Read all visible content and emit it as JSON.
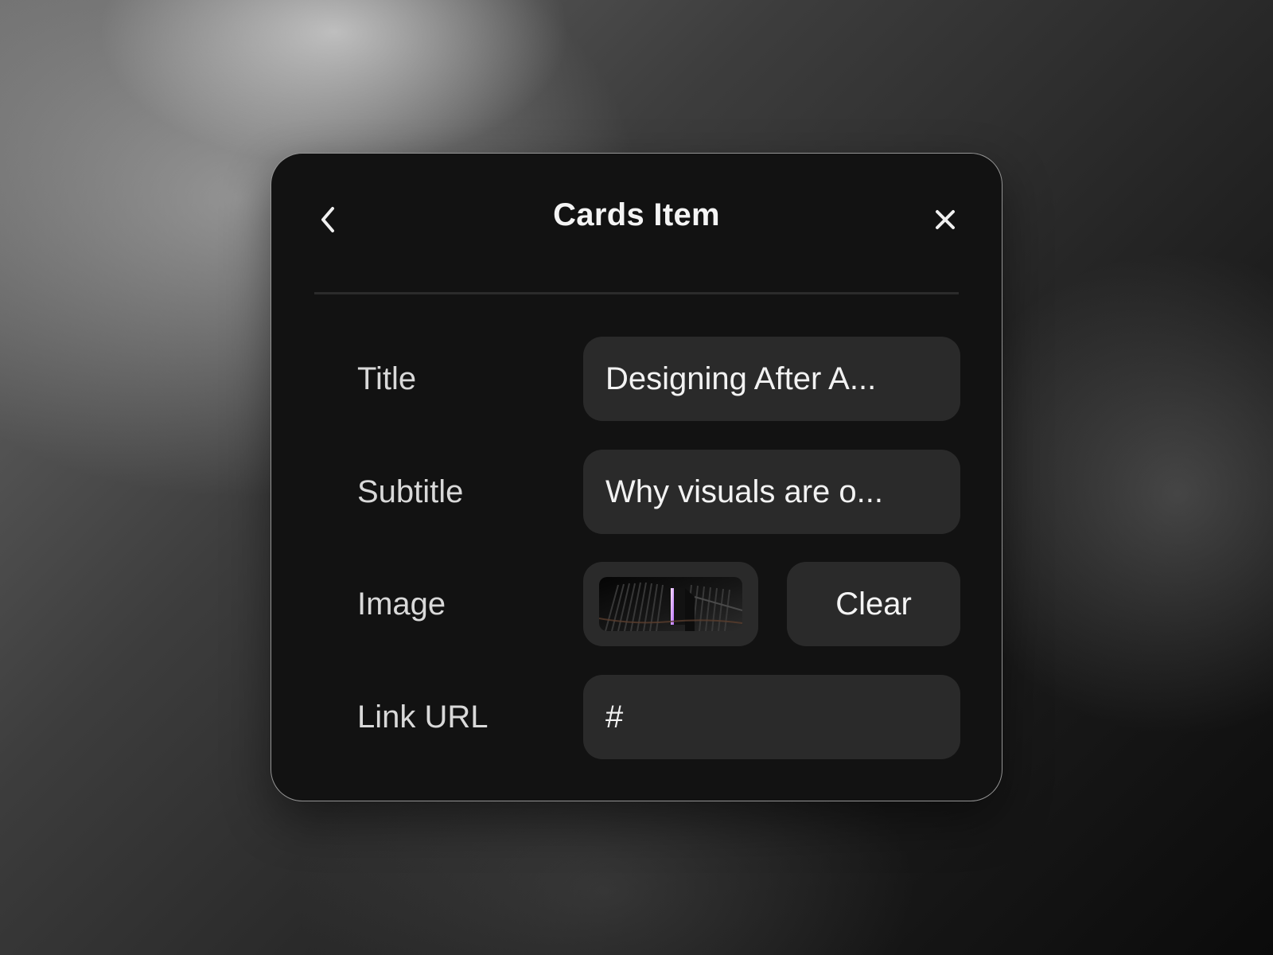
{
  "dialog": {
    "title": "Cards Item",
    "back_icon": "chevron-left-icon",
    "close_icon": "close-icon"
  },
  "fields": {
    "title": {
      "label": "Title",
      "value": "Designing After A..."
    },
    "subtitle": {
      "label": "Subtitle",
      "value": "Why visuals are o..."
    },
    "image": {
      "label": "Image",
      "thumbnail": "abstract-3d-thumbnail",
      "clear_label": "Clear"
    },
    "link": {
      "label": "Link URL",
      "value": "#"
    }
  },
  "colors": {
    "panel_background": "#121212",
    "field_background": "#2a2a2a",
    "text_primary": "#f4f4f4",
    "text_secondary": "#d9d9d9",
    "thumbnail_accent": "#d9a4ff"
  }
}
